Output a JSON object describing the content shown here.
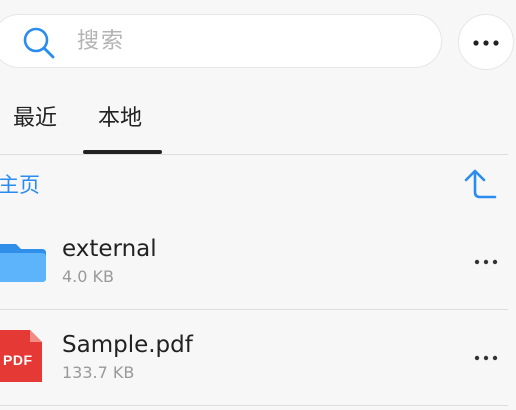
{
  "search": {
    "placeholder": "搜索"
  },
  "tabs": [
    {
      "label": "最近",
      "active": false
    },
    {
      "label": "本地",
      "active": true
    }
  ],
  "breadcrumb": {
    "label": "主页"
  },
  "files": [
    {
      "name": "external",
      "size": "4.0 KB",
      "type": "folder"
    },
    {
      "name": "Sample.pdf",
      "size": "133.7 KB",
      "type": "pdf",
      "badge": "PDF"
    }
  ],
  "colors": {
    "accent": "#2a8cf0",
    "folder": "#3aa0f5",
    "pdf": "#e53935"
  },
  "icons": {
    "search": "search-icon",
    "more": "more-horizontal-icon",
    "up": "arrow-up-icon",
    "folder": "folder-icon",
    "pdf": "pdf-file-icon"
  }
}
